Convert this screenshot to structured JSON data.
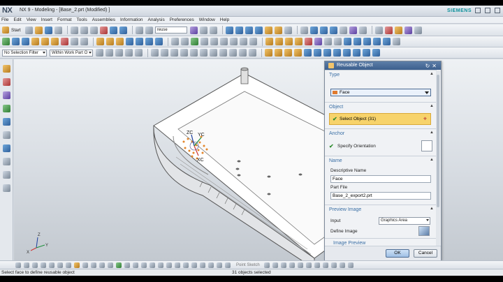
{
  "window": {
    "logo": "NX",
    "title": "NX 9 - Modeling - [Base_2.prt (Modified) ]",
    "brand": "SIEMENS"
  },
  "menubar": {
    "items": [
      "File",
      "Edit",
      "View",
      "Insert",
      "Format",
      "Tools",
      "Assemblies",
      "Information",
      "Analysis",
      "Preferences",
      "Window",
      "Help"
    ]
  },
  "toolbar": {
    "start_label": "Start",
    "command_search": "reuse",
    "selection_filter": "No Selection Filter",
    "selection_scope": "Within Work Part O",
    "sketch_label": "Point Sketch"
  },
  "viewport": {
    "triad": {
      "zc": "ZC",
      "yc": "YC",
      "xc": "XC"
    },
    "view_triad": {
      "z": "Z",
      "y": "Y",
      "x": "X"
    }
  },
  "dialog": {
    "title": "Reusable Object",
    "type_section": "Type",
    "type_value": "Face",
    "object_section": "Object",
    "select_object": "Select Object (31)",
    "anchor_section": "Anchor",
    "specify_orientation": "Specify Orientation",
    "name_section": "Name",
    "descriptive_name_label": "Descriptive Name",
    "descriptive_name_value": "Face",
    "part_file_label": "Part File",
    "part_file_value": "Base_2_export2.prt",
    "preview_section": "Preview Image",
    "input_label": "Input",
    "input_value": "Graphics Area",
    "define_image_label": "Define Image",
    "image_preview_section": "Image Preview",
    "ok_label": "OK",
    "cancel_label": "Cancel"
  },
  "status": {
    "prompt": "Select face to define reusable object",
    "selection_count": "31 objects selected"
  }
}
